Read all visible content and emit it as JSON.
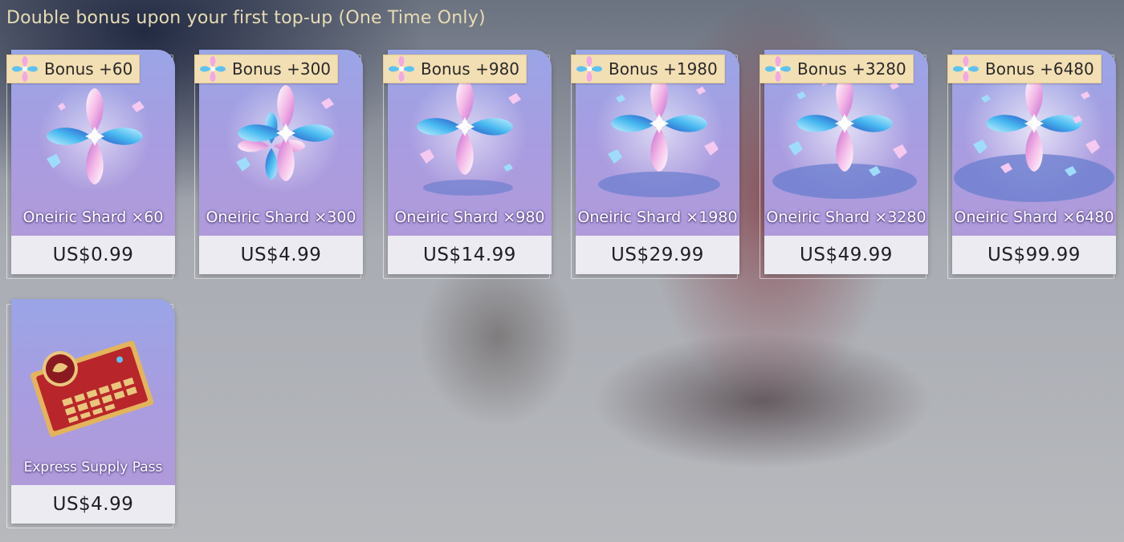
{
  "headline": "Double bonus upon your first top-up (One Time Only)",
  "products": [
    {
      "bonus": "Bonus +60",
      "name": "Oneiric Shard ×60",
      "price": "US$0.99",
      "icon": "oneiric-shard-icon"
    },
    {
      "bonus": "Bonus +300",
      "name": "Oneiric Shard ×300",
      "price": "US$4.99",
      "icon": "oneiric-shard-icon"
    },
    {
      "bonus": "Bonus +980",
      "name": "Oneiric Shard ×980",
      "price": "US$14.99",
      "icon": "oneiric-shard-icon"
    },
    {
      "bonus": "Bonus +1980",
      "name": "Oneiric Shard ×1980",
      "price": "US$29.99",
      "icon": "oneiric-shard-icon"
    },
    {
      "bonus": "Bonus +3280",
      "name": "Oneiric Shard ×3280",
      "price": "US$49.99",
      "icon": "oneiric-shard-icon"
    },
    {
      "bonus": "Bonus +6480",
      "name": "Oneiric Shard ×6480",
      "price": "US$99.99",
      "icon": "oneiric-shard-icon"
    }
  ],
  "pass": {
    "name": "Express Supply Pass",
    "price": "US$4.99",
    "icon": "supply-pass-ticket-icon"
  },
  "colors": {
    "headline": "#e8dcb4",
    "card_top": "#9aa5e6",
    "card_bottom": "#b39ad8",
    "price_bar": "#ecebf1",
    "bonus_tag": "#f3dfb4",
    "pass_red": "#b8262b",
    "pass_gold": "#e3b45c"
  }
}
